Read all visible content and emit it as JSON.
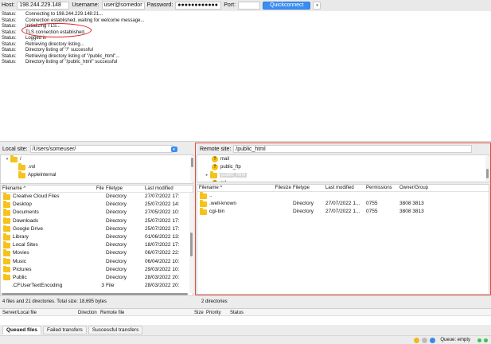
{
  "quickconnect": {
    "host_label": "Host:",
    "host_value": "198.244.229.148",
    "username_label": "Username:",
    "username_value": "user@somedon",
    "password_label": "Password:",
    "password_value": "●●●●●●●●●●●●",
    "port_label": "Port:",
    "port_value": "",
    "button_label": "Quickconnect",
    "dropdown_glyph": "▾"
  },
  "log": [
    {
      "type": "Status:",
      "text": "Connecting to 198.244.229.148:21..."
    },
    {
      "type": "Status:",
      "text": "Connection established, waiting for welcome message..."
    },
    {
      "type": "Status:",
      "text": "Initializing TLS..."
    },
    {
      "type": "Status:",
      "text": "TLS connection established."
    },
    {
      "type": "Status:",
      "text": "Logged in"
    },
    {
      "type": "Status:",
      "text": "Retrieving directory listing..."
    },
    {
      "type": "Status:",
      "text": "Directory listing of \"/\" successful"
    },
    {
      "type": "Status:",
      "text": "Retrieving directory listing of \"/public_html\"..."
    },
    {
      "type": "Status:",
      "text": "Directory listing of \"/public_html\" successful"
    }
  ],
  "local": {
    "site_label": "Local site:",
    "path": "/Users/someuser/",
    "tree": [
      {
        "name": "/",
        "level": 0,
        "expanded": true
      },
      {
        "name": ".vol",
        "level": 1
      },
      {
        "name": "AppleInternal",
        "level": 1
      }
    ],
    "columns": [
      "Filename ^",
      "Filesize",
      "Filetype",
      "Last modified"
    ],
    "rows": [
      {
        "name": "Creative Cloud Files",
        "size": "",
        "type": "Directory",
        "modified": "27/07/2022 17:"
      },
      {
        "name": "Desktop",
        "size": "",
        "type": "Directory",
        "modified": "25/07/2022 14:"
      },
      {
        "name": "Documents",
        "size": "",
        "type": "Directory",
        "modified": "27/05/2022 10:"
      },
      {
        "name": "Downloads",
        "size": "",
        "type": "Directory",
        "modified": "25/07/2022 17:"
      },
      {
        "name": "Google Drive",
        "size": "",
        "type": "Directory",
        "modified": "25/07/2022 17:"
      },
      {
        "name": "Library",
        "size": "",
        "type": "Directory",
        "modified": "01/06/2022 13:"
      },
      {
        "name": "Local Sites",
        "size": "",
        "type": "Directory",
        "modified": "18/07/2022 17:"
      },
      {
        "name": "Movies",
        "size": "",
        "type": "Directory",
        "modified": "06/07/2022 22:"
      },
      {
        "name": "Music",
        "size": "",
        "type": "Directory",
        "modified": "06/04/2022 10:"
      },
      {
        "name": "Pictures",
        "size": "",
        "type": "Directory",
        "modified": "29/03/2022 10:"
      },
      {
        "name": "Public",
        "size": "",
        "type": "Directory",
        "modified": "28/03/2022 20:"
      },
      {
        "name": ".CFUserTextEncoding",
        "size": "3",
        "type": "File",
        "modified": "28/03/2022 20:"
      }
    ],
    "status": "4 files and 21 directories. Total size: 18,695 bytes"
  },
  "remote": {
    "site_label": "Remote site:",
    "path": "/public_html",
    "tree": [
      {
        "name": "mail",
        "icon": "question"
      },
      {
        "name": "public_ftp",
        "icon": "question"
      },
      {
        "name": "public_html",
        "icon": "folder",
        "selected": true
      },
      {
        "name": "ssl",
        "icon": "question"
      }
    ],
    "columns": [
      "Filename ^",
      "Filesize",
      "Filetype",
      "Last modified",
      "Permissions",
      "Owner/Group"
    ],
    "rows": [
      {
        "name": "..",
        "size": "",
        "type": "",
        "modified": "",
        "perm": "",
        "owner": ""
      },
      {
        "name": ".well-known",
        "size": "",
        "type": "Directory",
        "modified": "27/07/2022 1...",
        "perm": "0755",
        "owner": "3808 3813"
      },
      {
        "name": "cgi-bin",
        "size": "",
        "type": "Directory",
        "modified": "27/07/2022 1...",
        "perm": "0755",
        "owner": "3808 3813"
      }
    ],
    "status": "2 directories"
  },
  "queue": {
    "columns": [
      "Server/Local file",
      "Direction",
      "Remote file",
      "Size",
      "Priority",
      "Status"
    ],
    "tabs": [
      "Queued files",
      "Failed transfers",
      "Successful transfers"
    ],
    "status_text": "Queue: empty"
  },
  "colors": {
    "accent": "#3b8ef0",
    "folder": "#f6c21b",
    "highlight": "#e04a3a"
  }
}
